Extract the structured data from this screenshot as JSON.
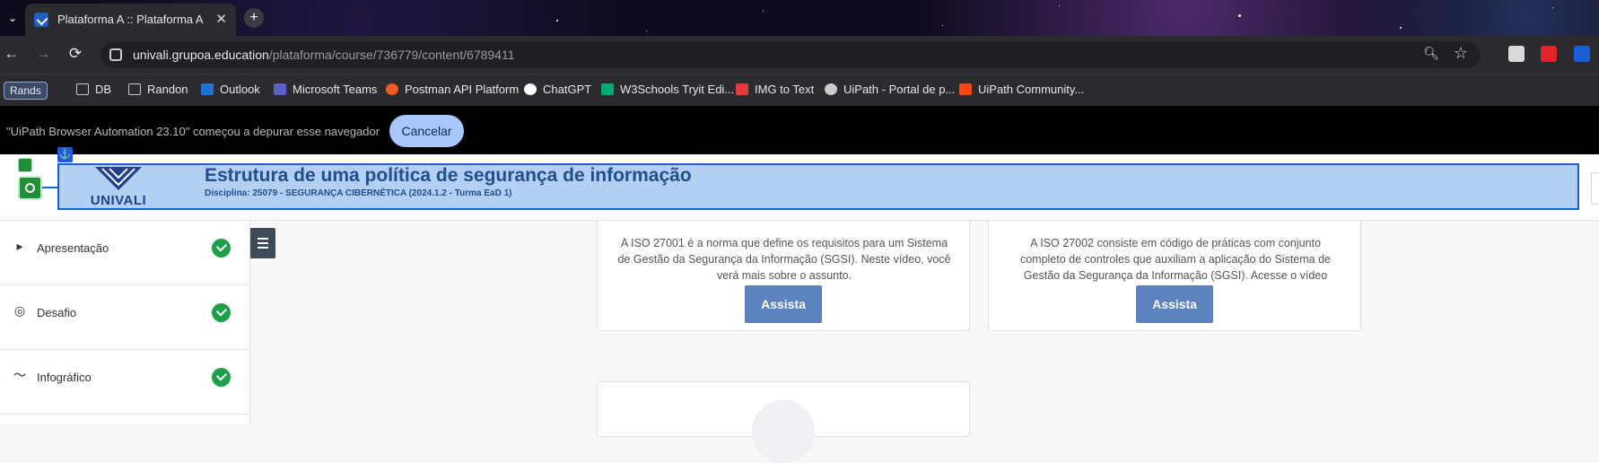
{
  "browser": {
    "tab_title": "Plataforma A :: Plataforma A",
    "tab_close": "✕",
    "new_tab": "+",
    "url_host": "univali.grupoa.education",
    "url_path": "/plataforma/course/736779/content/6789411",
    "nav": {
      "back": "←",
      "forward": "→",
      "reload": "⟳"
    }
  },
  "bookmarks": {
    "profile_chip": "Rands",
    "items": [
      {
        "label": "DB",
        "icon": "folder-icon"
      },
      {
        "label": "Randon",
        "icon": "folder-icon"
      },
      {
        "label": "Outlook",
        "icon": "outlook-icon",
        "color": "#1e73d8"
      },
      {
        "label": "Microsoft Teams",
        "icon": "teams-icon",
        "color": "#5b5fc7"
      },
      {
        "label": "Postman API Platform",
        "icon": "postman-icon",
        "color": "#ef5b25"
      },
      {
        "label": "ChatGPT",
        "icon": "chatgpt-icon",
        "color": "#ffffff"
      },
      {
        "label": "W3Schools Tryit Edi...",
        "icon": "w3schools-icon",
        "color": "#04aa6d"
      },
      {
        "label": "IMG to Text",
        "icon": "img-to-text-icon",
        "color": "#e23b3b"
      },
      {
        "label": "UiPath - Portal de p...",
        "icon": "uipath-globe-icon",
        "color": "#cccccc"
      },
      {
        "label": "UiPath Community...",
        "icon": "uipath-icon",
        "color": "#fa4616"
      }
    ]
  },
  "debug_bar": {
    "message": "\"UiPath Browser Automation 23.10\" começou a depurar esse navegador",
    "cancel_label": "Cancelar"
  },
  "header": {
    "logo_text": "UNIVALI",
    "title": "Estrutura de uma política de segurança de informação",
    "subtitle": "Disciplina: 25079 - SEGURANÇA CIBERNÉTICA (2024.1.2 - Turma EaD 1)",
    "anchor_glyph": "⚓"
  },
  "sidebar": {
    "items": [
      {
        "label": "Apresentação",
        "icon": "play-icon",
        "completed": true
      },
      {
        "label": "Desafio",
        "icon": "target-icon",
        "completed": true
      },
      {
        "label": "Infográfico",
        "icon": "chart-line-icon",
        "completed": true
      }
    ]
  },
  "cards": [
    {
      "description": "A ISO 27001 é a norma que define os requisitos para um Sistema de Gestão da Segurança da Informação (SGSI). Neste vídeo, você verá mais sobre o assunto.",
      "button": "Assista"
    },
    {
      "description": "A ISO 27002 consiste em código de práticas com conjunto completo de controles que auxiliam a aplicação do Sistema de Gestão da Segurança da Informação (SGSI). Acesse o vídeo indicado.",
      "button": "Assista"
    }
  ],
  "colors": {
    "accent": "#5c82c0",
    "header_text": "#224e8c",
    "completed": "#1ca04a",
    "uipath_highlight": "#1a5fd8"
  }
}
